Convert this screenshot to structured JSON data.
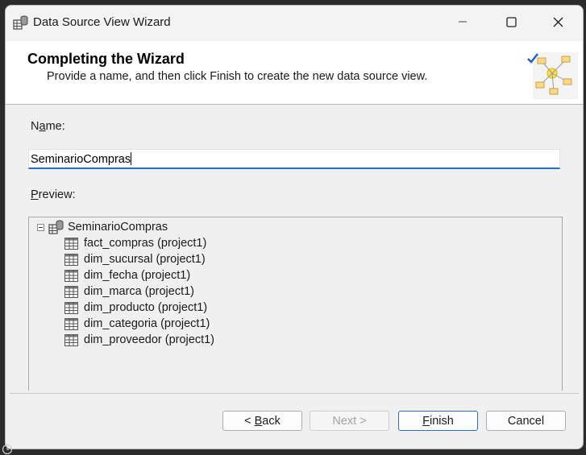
{
  "window": {
    "title": "Data Source View Wizard",
    "app_icon": "data-source-view-icon",
    "controls": {
      "minimize": "minimize-icon",
      "maximize": "maximize-icon",
      "close": "close-icon"
    }
  },
  "header": {
    "title": "Completing the Wizard",
    "subtitle": "Provide a name, and then click Finish to create the new data source view.",
    "graphic": "wizard-graphic-icon"
  },
  "name": {
    "label_before": "N",
    "label_accel": "a",
    "label_after": "me:",
    "value": "SeminarioCompras"
  },
  "preview": {
    "label_accel": "P",
    "label_after": "review:",
    "root": "SeminarioCompras",
    "items": [
      "fact_compras (project1)",
      "dim_sucursal (project1)",
      "dim_fecha (project1)",
      "dim_marca (project1)",
      "dim_producto (project1)",
      "dim_categoria (project1)",
      "dim_proveedor (project1)"
    ]
  },
  "buttons": {
    "back_prefix": "< ",
    "back_accel": "B",
    "back_rest": "ack",
    "next": "Next >",
    "finish_accel": "F",
    "finish_rest": "inish",
    "cancel": "Cancel"
  },
  "colors": {
    "accent": "#1f6fc7",
    "window_bg": "#f0f0f0",
    "header_bg": "#ffffff"
  }
}
